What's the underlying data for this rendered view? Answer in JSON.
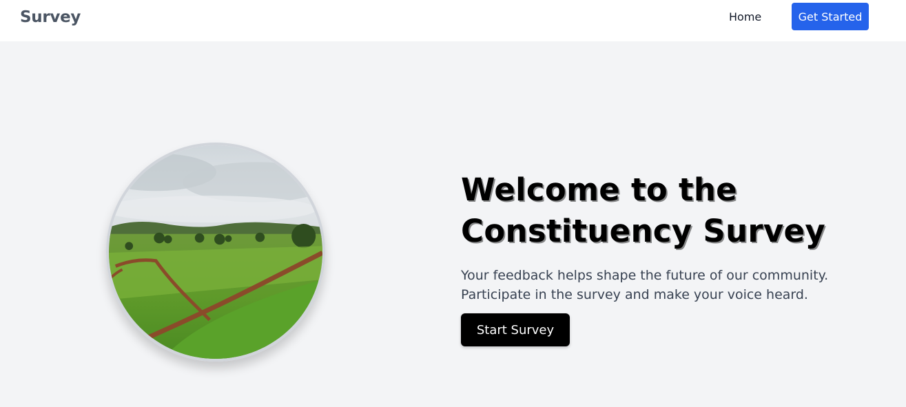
{
  "header": {
    "brand": "Survey",
    "nav": {
      "home_label": "Home"
    },
    "cta_label": "Get Started"
  },
  "hero": {
    "image_alt": "Green field landscape with dirt path",
    "title": "Welcome to the Constituency Survey",
    "description": "Your feedback helps shape the future of our community. Participate in the survey and make your voice heard.",
    "button_label": "Start Survey"
  },
  "colors": {
    "primary": "#2563eb",
    "background": "#f3f4f6",
    "text_muted": "#4b5563",
    "button_dark": "#000000"
  }
}
